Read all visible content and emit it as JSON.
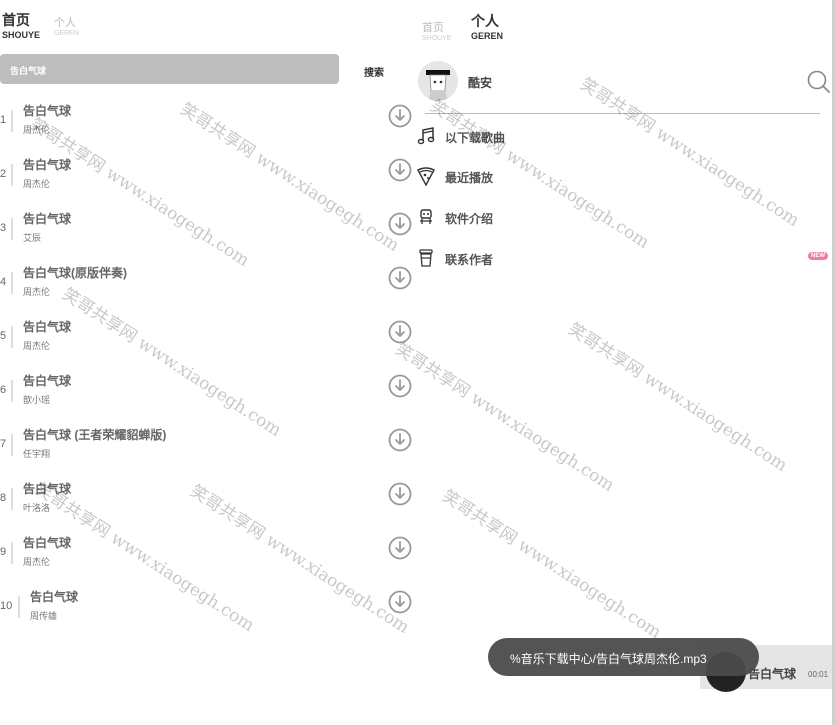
{
  "left_tabs": [
    {
      "main": "首页",
      "sub": "SHOUYE"
    },
    {
      "main": "个人",
      "sub": "GEREN"
    }
  ],
  "right_tabs": [
    {
      "main": "首页",
      "sub": "SHOUYE"
    },
    {
      "main": "个人",
      "sub": "GEREN"
    }
  ],
  "search": {
    "query": "告白气球",
    "button_label": "搜索"
  },
  "songs": [
    {
      "num": "1",
      "title": "告白气球",
      "artist": "周杰伦"
    },
    {
      "num": "2",
      "title": "告白气球",
      "artist": "周杰伦"
    },
    {
      "num": "3",
      "title": "告白气球",
      "artist": "艾辰"
    },
    {
      "num": "4",
      "title": "告白气球(原版伴奏)",
      "artist": "周杰伦"
    },
    {
      "num": "5",
      "title": "告白气球",
      "artist": "周杰伦"
    },
    {
      "num": "6",
      "title": "告白气球",
      "artist": "歆小瑶"
    },
    {
      "num": "7",
      "title": "告白气球 (王者荣耀貂蝉版)",
      "artist": "任宇翔"
    },
    {
      "num": "8",
      "title": "告白气球",
      "artist": "叶洛洛"
    },
    {
      "num": "9",
      "title": "告白气球",
      "artist": "周杰伦"
    },
    {
      "num": "10",
      "title": "告白气球",
      "artist": "周传雄"
    }
  ],
  "profile": {
    "username": "酷安"
  },
  "menu": [
    {
      "label": "以下载歌曲",
      "icon": "music-note-icon"
    },
    {
      "label": "最近播放",
      "icon": "pizza-icon"
    },
    {
      "label": "软件介绍",
      "icon": "robot-icon"
    },
    {
      "label": "联系作者",
      "icon": "cup-icon"
    }
  ],
  "badge": "NEW",
  "toast": "%音乐下载中心/告白气球周杰伦.mp3",
  "mini_player": {
    "title": "告白气球",
    "time": "00:01"
  },
  "watermark": "笑哥共享网 www.xiaogegh.com",
  "colors": {
    "search_bar": "#bdbdbd",
    "badge": "#f27aa6",
    "toast": "#4b4b4b"
  }
}
